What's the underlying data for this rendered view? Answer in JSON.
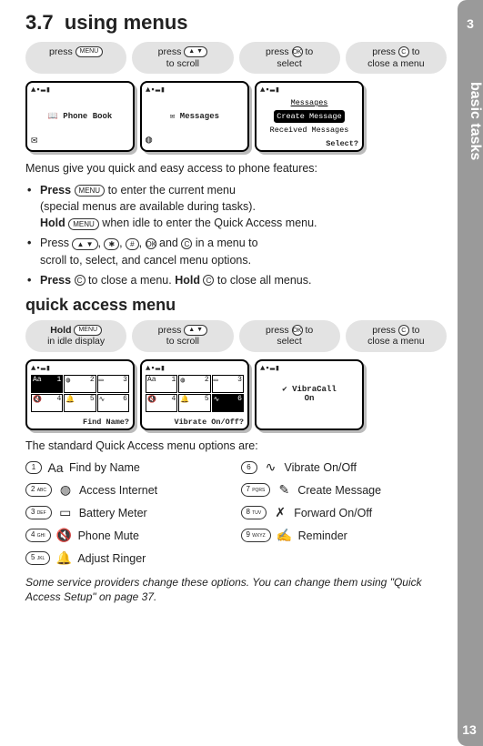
{
  "side": {
    "chapter": "3",
    "label": "basic tasks"
  },
  "page_number": "13",
  "section": {
    "number": "3.7",
    "title": "using menus"
  },
  "pills1": {
    "p1a": "press ",
    "p1b": "MENU",
    "p2a": "press ",
    "p2b": "▲  ▼",
    "p2c": "to scroll",
    "p3a": "press ",
    "p3b": "OK",
    "p3c": " to",
    "p3d": "select",
    "p4a": "press ",
    "p4b": "C",
    "p4c": " to",
    "p4d": "close a menu"
  },
  "screens1": {
    "s1_top": "▲▪▬▮",
    "s1_mid": "Phone Book",
    "s2_top": "▲▪▬▮",
    "s2_mid": "Messages",
    "s3_top": "▲▪▬▮",
    "s3_t": "Messages",
    "s3_a": "Create Message",
    "s3_b": "Received Messages",
    "s3_sel": "Select?"
  },
  "intro": "Menus give you quick and easy access to phone features:",
  "bullets": {
    "b1_a": "Press ",
    "b1_key": "MENU",
    "b1_b": " to enter the current menu",
    "b1_c": "(special menus are available during tasks).",
    "b1_d": "Hold ",
    "b1_e": " when idle to enter the Quick Access menu.",
    "b2_a": "Press ",
    "b2_k1": "▲  ▼",
    "b2_k2": "✱",
    "b2_k3": "#",
    "b2_k4": "OK",
    "b2_k5": "C",
    "b2_b": " in a menu to",
    "b2_c": "scroll to, select, and cancel menu options.",
    "b3_a": "Press ",
    "b3_k": "C",
    "b3_b": " to close a menu. ",
    "b3_c": "Hold ",
    "b3_d": " to close all menus."
  },
  "subheading": "quick access menu",
  "pills2": {
    "p1a": "Hold ",
    "p1b": "MENU",
    "p1c": "in idle display",
    "p2a": "press ",
    "p2b": "▲  ▼",
    "p2c": "to scroll",
    "p3a": "press ",
    "p3b": "OK",
    "p3c": " to",
    "p3d": "select",
    "p4a": "press ",
    "p4b": "C",
    "p4c": " to",
    "p4d": "close a menu"
  },
  "screens2": {
    "s1_top": "▲▪▬▮",
    "s1_cells": [
      "1",
      "2",
      "3",
      "4",
      "5",
      "6"
    ],
    "s1_bottom": "Find Name?",
    "s2_top": "▲▪▬▮",
    "s2_cells": [
      "1",
      "2",
      "3",
      "4",
      "5",
      "6"
    ],
    "s2_bottom": "Vibrate On/Off?",
    "s3_top": "▲▪▬▮",
    "s3_line1": "VibraCall",
    "s3_line2": "On"
  },
  "options_intro": "The standard Quick Access menu options are:",
  "options": [
    {
      "n": "1",
      "icon": "Aa",
      "label": "Find by Name"
    },
    {
      "n": "6",
      "icon": "∿",
      "label": "Vibrate On/Off"
    },
    {
      "n": "2",
      "key": "ABC",
      "icon": "◍",
      "label": "Access Internet"
    },
    {
      "n": "7",
      "key": "PQRS",
      "icon": "✎",
      "label": "Create Message"
    },
    {
      "n": "3",
      "key": "DEF",
      "icon": "▭",
      "label": "Battery Meter"
    },
    {
      "n": "8",
      "key": "TUV",
      "icon": "✗",
      "label": "Forward On/Off"
    },
    {
      "n": "4",
      "key": "GHI",
      "icon": "🔇",
      "label": "Phone Mute"
    },
    {
      "n": "9",
      "key": "WXYZ",
      "icon": "✍",
      "label": "Reminder"
    },
    {
      "n": "5",
      "key": "JKL",
      "icon": "🔔",
      "label": "Adjust Ringer"
    }
  ],
  "footnote": "Some service providers change these options. You can change them using \"Quick Access Setup\" on page 37."
}
